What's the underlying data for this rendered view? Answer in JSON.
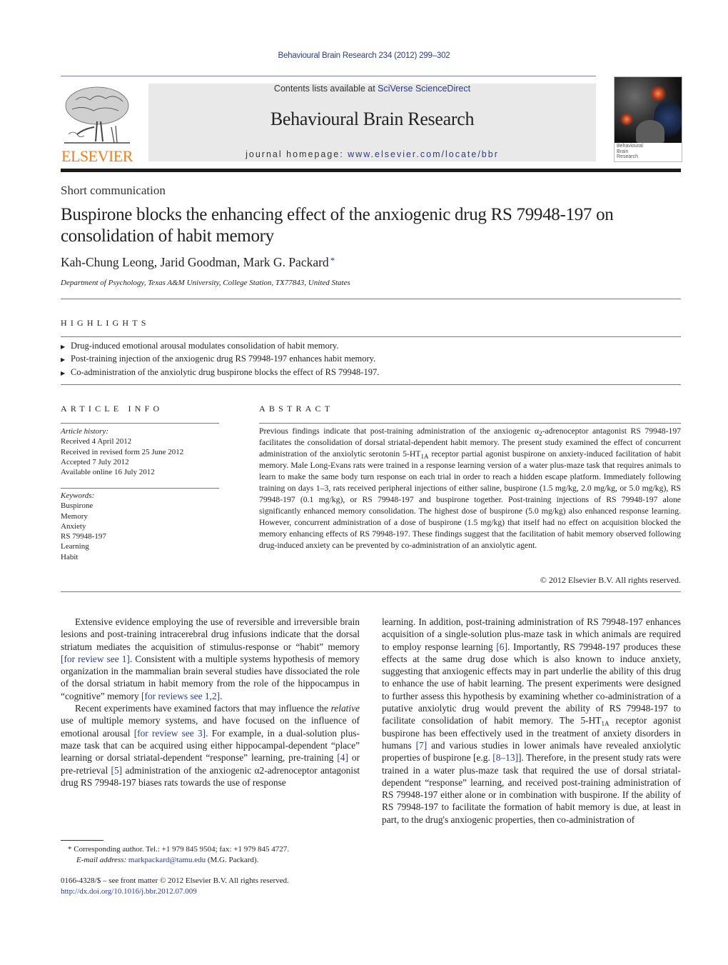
{
  "header": {
    "citation": "Behavioural Brain Research 234 (2012) 299–302",
    "contents_prefix": "Contents lists available at ",
    "contents_link": "SciVerse ScienceDirect",
    "journal_title": "Behavioural Brain Research",
    "homepage_prefix": "journal homepage: ",
    "homepage_link": "www.elsevier.com/locate/bbr",
    "publisher_logo_text": "ELSEVIER",
    "cover_title_lines": [
      "Behavioural",
      "Brain",
      "Research"
    ]
  },
  "article": {
    "type": "Short communication",
    "title": "Buspirone blocks the enhancing effect of the anxiogenic drug RS 79948-197 on consolidation of habit memory",
    "authors": "Kah-Chung Leong, Jarid Goodman, Mark G. Packard",
    "corresponding_marker": "*",
    "affiliation": "Department of Psychology, Texas A&M University, College Station, TX77843, United States"
  },
  "highlights": {
    "heading": "HIGHLIGHTS",
    "items": [
      "Drug-induced emotional arousal modulates consolidation of habit memory.",
      "Post-training injection of the anxiogenic drug RS 79948-197 enhances habit memory.",
      "Co-administration of the anxiolytic drug buspirone blocks the effect of RS 79948-197."
    ]
  },
  "article_info": {
    "heading": "ARTICLE INFO",
    "history_label": "Article history:",
    "history": [
      "Received 4 April 2012",
      "Received in revised form 25 June 2012",
      "Accepted 7 July 2012",
      "Available online 16 July 2012"
    ],
    "keywords_label": "Keywords:",
    "keywords": [
      "Buspirone",
      "Memory",
      "Anxiety",
      "RS 79948-197",
      "Learning",
      "Habit"
    ]
  },
  "abstract": {
    "heading": "ABSTRACT",
    "part1": "Previous findings indicate that post-training administration of the anxiogenic α",
    "sub1": "2",
    "part2": "-adrenoceptor antagonist RS 79948-197 facilitates the consolidation of dorsal striatal-dependent habit memory. The present study examined the effect of concurrent administration of the anxiolytic serotonin 5-HT",
    "sub2": "1A",
    "part3": " receptor partial agonist buspirone on anxiety-induced facilitation of habit memory. Male Long-Evans rats were trained in a response learning version of a water plus-maze task that requires animals to learn to make the same body turn response on each trial in order to reach a hidden escape platform. Immediately following training on days 1–3, rats received peripheral injections of either saline, buspirone (1.5 mg/kg, 2.0 mg/kg, or 5.0 mg/kg), RS 79948-197 (0.1 mg/kg), or RS 79948-197 and buspirone together. Post-training injections of RS 79948-197 alone significantly enhanced memory consolidation. The highest dose of buspirone (5.0 mg/kg) also enhanced response learning. However, concurrent administration of a dose of buspirone (1.5 mg/kg) that itself had no effect on acquisition blocked the memory enhancing effects of RS 79948-197. These findings suggest that the facilitation of habit memory observed following drug-induced anxiety can be prevented by co-administration of an anxiolytic agent.",
    "copyright": "© 2012 Elsevier B.V. All rights reserved."
  },
  "body": {
    "left": {
      "p1_a": "Extensive evidence employing the use of reversible and irreversible brain lesions and post-training intracerebral drug infusions indicate that the dorsal striatum mediates the acquisition of stimulus-response or “habit” memory ",
      "p1_ref1": "[for review see 1]",
      "p1_b": ". Consistent with a multiple systems hypothesis of memory organization in the mammalian brain several studies have dissociated the role of the dorsal striatum in habit memory from the role of the hippocampus in “cognitive” memory ",
      "p1_ref2": "[for reviews see 1,2]",
      "p1_c": ".",
      "p2_a": "Recent experiments have examined factors that may influence the ",
      "p2_ital": "relative",
      "p2_b": " use of multiple memory systems, and have focused on the influence of emotional arousal ",
      "p2_ref1": "[for review see 3]",
      "p2_c": ". For example, in a dual-solution plus-maze task that can be acquired using either hippocampal-dependent “place” learning or dorsal striatal-dependent “response” learning, pre-training ",
      "p2_ref2": "[4]",
      "p2_d": " or pre-retrieval ",
      "p2_ref3": "[5]",
      "p2_e": " administration of the anxiogenic α2-adrenoceptor antagonist drug RS 79948-197 biases rats towards the use of response"
    },
    "right": {
      "a": "learning. In addition, post-training administration of RS 79948-197 enhances acquisition of a single-solution plus-maze task in which animals are required to employ response learning ",
      "ref1": "[6]",
      "b": ". Importantly, RS 79948-197 produces these effects at the same drug dose which is also known to induce anxiety, suggesting that anxiogenic effects may in part underlie the ability of this drug to enhance the use of habit learning. The present experiments were designed to further assess this hypothesis by examining whether co-administration of a putative anxiolytic drug would prevent the ability of RS 79948-197 to facilitate consolidation of habit memory. The 5-HT",
      "sub": "1A",
      "c": " receptor agonist buspirone has been effectively used in the treatment of anxiety disorders in humans ",
      "ref2": "[7]",
      "d": " and various studies in lower animals have revealed anxiolytic properties of buspirone [e.g. ",
      "ref3": "[8–13]",
      "e": "]. Therefore, in the present study rats were trained in a water plus-maze task that required the use of dorsal striatal-dependent “response” learning, and received post-training administration of RS 79948-197 either alone or in combination with buspirone. If the ability of RS 79948-197 to facilitate the formation of habit memory is due, at least in part, to the drug's anxiogenic properties, then co-administration of"
    }
  },
  "footnote": {
    "marker": "*",
    "text": "Corresponding author. Tel.: +1 979 845 9504; fax: +1 979 845 4727.",
    "email_label": "E-mail address:",
    "email": "markpackard@tamu.edu",
    "email_suffix": " (M.G. Packard)."
  },
  "issn": {
    "line": "0166-4328/$ – see front matter © 2012 Elsevier B.V. All rights reserved.",
    "doi": "http://dx.doi.org/10.1016/j.bbr.2012.07.009"
  },
  "colors": {
    "link": "#2b3a8c",
    "elsevier_orange": "#f07d1c",
    "header_band": "#e9e9ea"
  }
}
